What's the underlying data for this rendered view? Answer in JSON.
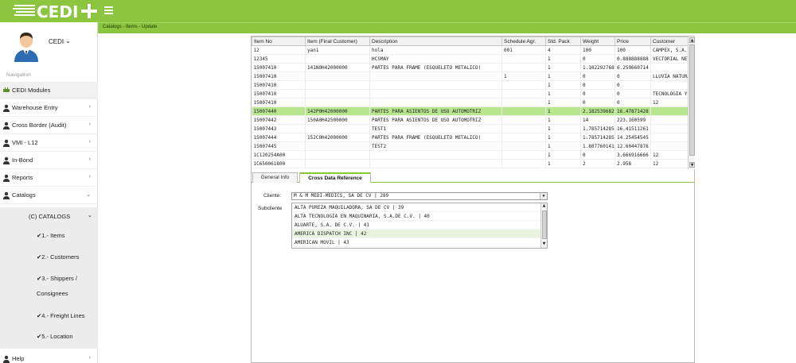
{
  "app": {
    "logo_text": "CEDI"
  },
  "breadcrumb": "Catalogs - Items - Update",
  "user": {
    "name": "CEDI"
  },
  "sidebar": {
    "nav_label": "Navigation",
    "items": [
      {
        "label": "CEDI Modules",
        "icon": "plug-icon"
      },
      {
        "label": "Warehouse Entry",
        "icon": "user-icon"
      },
      {
        "label": "Cross Border (Audit)",
        "icon": "user-icon"
      },
      {
        "label": "VMI - L12",
        "icon": "user-icon"
      },
      {
        "label": "In-Bond",
        "icon": "user-icon"
      },
      {
        "label": "Reports",
        "icon": "user-icon"
      },
      {
        "label": "Catalogs",
        "icon": "user-icon"
      },
      {
        "label": "Help",
        "icon": "user-icon"
      }
    ],
    "catalogs_group": "(C) CATALOGS",
    "catalog_items": [
      "1.- Items",
      "2.- Customers",
      "3.- Shippers /",
      "Consignees",
      "4.- Freight Lines",
      "5.- Location"
    ]
  },
  "grid": {
    "columns": [
      "Item No",
      "Item (Final Customer)",
      "Description",
      "Schedule Agr.",
      "Std. Pack",
      "Weight",
      "Price",
      "Customer"
    ],
    "rows": [
      [
        "12",
        "yan1",
        "hola",
        "001",
        "4",
        "100",
        "100",
        "CAMPEX, S.A."
      ],
      [
        "12345",
        "",
        "HCSMAY",
        "",
        "1",
        "0",
        "0.888888888",
        "VECTORIAL NET"
      ],
      [
        "15007410",
        "141N0H42000000",
        "PARTES PARA FRAME (ESQUELETO METALICO)",
        "",
        "1",
        "1.102292768",
        "6.259660714",
        ""
      ],
      [
        "15007410",
        "",
        "",
        "1",
        "1",
        "0",
        "0",
        "LLUVIA NATURA"
      ],
      [
        "15007410",
        "",
        "",
        "",
        "1",
        "0",
        "0",
        ""
      ],
      [
        "15007410",
        "",
        "",
        "",
        "1",
        "0",
        "0",
        "TECNOLOGIA Y"
      ],
      [
        "15007410",
        "",
        "",
        "",
        "1",
        "0",
        "0",
        "12"
      ],
      [
        "15007440",
        "142P0H42000000",
        "PARTES PARA ASIENTOS DE USO AUTOMOTRIZ",
        "",
        "1",
        "2.182539682",
        "16.47871428",
        ""
      ],
      [
        "15007442",
        "150A0H42500000",
        "PARTES PARA ASIENTOS DE USO AUTOMOTRIZ",
        "",
        "1",
        "14",
        "223.160599",
        ""
      ],
      [
        "15007443",
        "",
        "TEST1",
        "",
        "1",
        "1.785714285",
        "16.41511261",
        ""
      ],
      [
        "15007444",
        "152C0H42000000",
        "PARTES PARA FRAME (ESQUELETO METALICO)",
        "",
        "1",
        "1.785714285",
        "14.25454545",
        ""
      ],
      [
        "15007445",
        "",
        "TEST2",
        "",
        "1",
        "1.807760141",
        "12.60447876",
        ""
      ],
      [
        "1C120254A00",
        "",
        "",
        "",
        "1",
        "0",
        "3.666916666",
        "12"
      ],
      [
        "1C650061800",
        "",
        "",
        "",
        "1",
        "2",
        "2.958",
        "12"
      ]
    ],
    "selected_row": 7
  },
  "tabs": [
    "General Info",
    "Cross Data Reference"
  ],
  "form": {
    "cliente_label": "Cliente:",
    "cliente_value": "M & M MEDI-MEDICS, SA DE CV | 289",
    "subcliente_label": "Subcliente",
    "subcliente_options": [
      "ALTA PUREZA MAQUILADORA, SA DE CV | 39",
      "ALTA TECNOLOGIA EN MAQUINARIA, S.A.DE C.V. | 40",
      "ALUARTE, S.A. DE C.V. | 41",
      "AMERICA DISPATCH INC | 42",
      "AMERICAN MOVIL | 43"
    ],
    "highlighted_option": 3
  },
  "colors": {
    "brand_green": "#8cc540",
    "selected_row": "#b7e68f"
  }
}
